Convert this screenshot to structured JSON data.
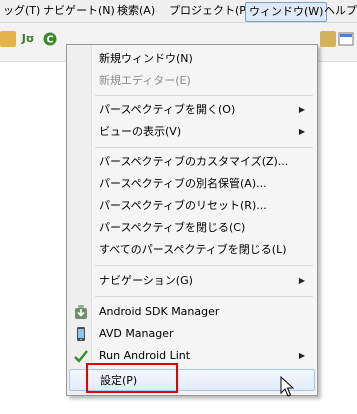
{
  "menubar": {
    "items": [
      {
        "label": "ッグ(T)"
      },
      {
        "label": "ナビゲート(N)"
      },
      {
        "label": "検索(A)"
      },
      {
        "label": "プロジェクト(P)"
      },
      {
        "label": "ウィンドウ(W)"
      },
      {
        "label": "ヘルプ("
      }
    ],
    "active_index": 4
  },
  "toolbar": {
    "icons": [
      "package-icon",
      "junit-icon",
      "java-class-icon",
      "perspective-icon"
    ]
  },
  "menu": {
    "items": [
      {
        "label": "新規ウィンドウ(N)",
        "enabled": true
      },
      {
        "label": "新規エディター(E)",
        "enabled": false
      },
      {
        "label": "パースペクティブを開く(O)",
        "submenu": true
      },
      {
        "label": "ビューの表示(V)",
        "submenu": true
      },
      {
        "label": "パースペクティブのカスタマイズ(Z)..."
      },
      {
        "label": "パースペクティブの別名保管(A)..."
      },
      {
        "label": "パースペクティブのリセット(R)..."
      },
      {
        "label": "パースペクティブを閉じる(C)"
      },
      {
        "label": "すべてのパースペクティブを閉じる(L)"
      },
      {
        "label": "ナビゲーション(G)",
        "submenu": true
      },
      {
        "label": "Android SDK Manager",
        "icon": "android-sdk-download-icon"
      },
      {
        "label": "AVD Manager",
        "icon": "android-phone-icon"
      },
      {
        "label": "Run Android Lint",
        "icon": "lint-check-icon",
        "submenu": true
      },
      {
        "label": "設定(P)",
        "hovered": true
      }
    ]
  },
  "colors": {
    "highlight_box": "#e60000",
    "hover_border": "#a8c6ea",
    "menubar_active": "#dde9f7"
  }
}
